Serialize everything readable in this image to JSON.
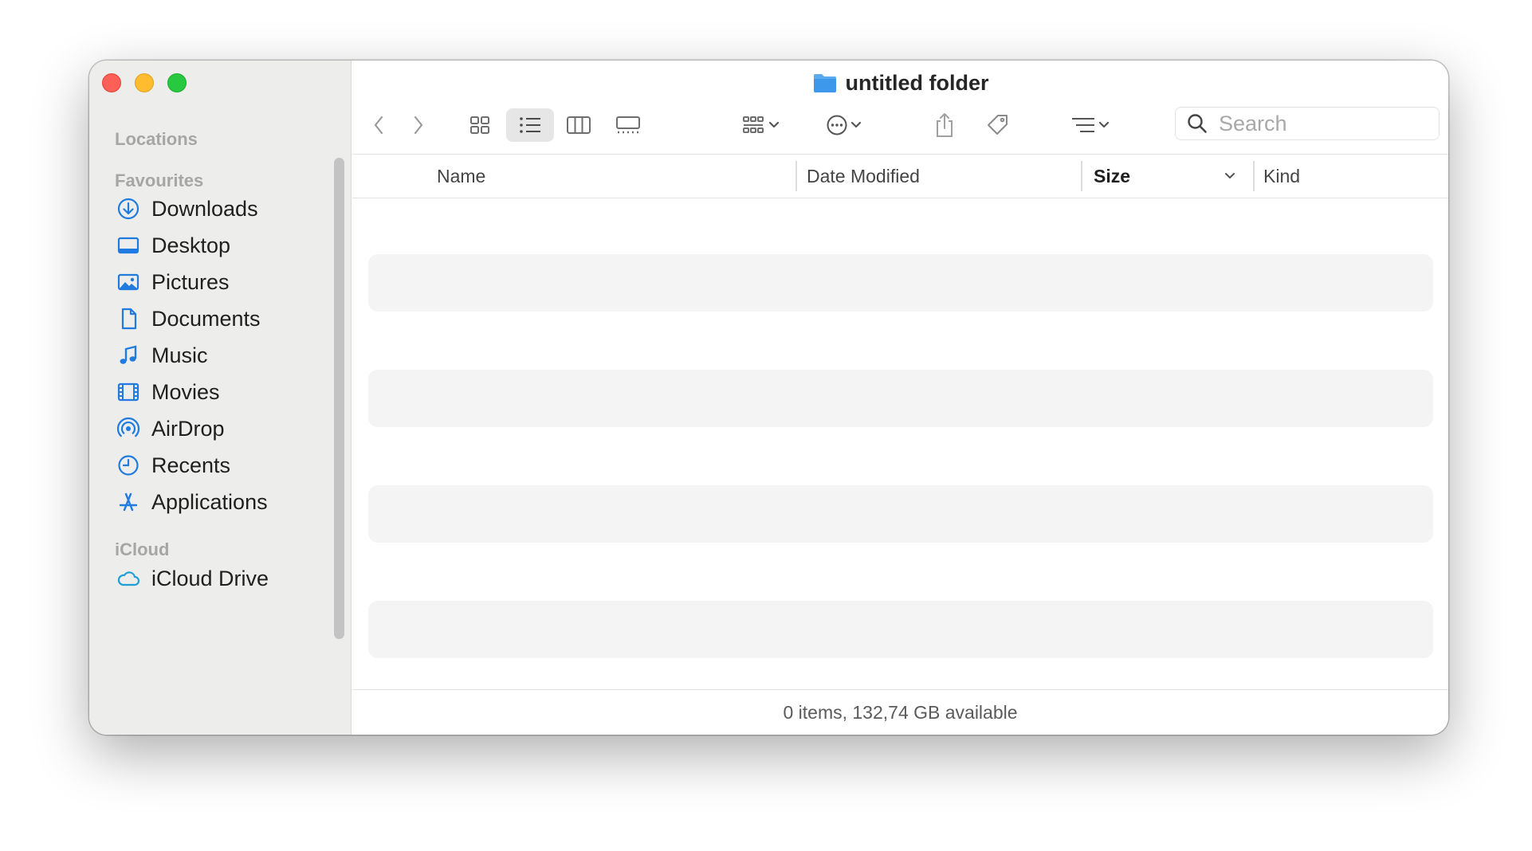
{
  "window": {
    "title": "untitled folder"
  },
  "sidebar": {
    "sections": {
      "locations": "Locations",
      "favourites": "Favourites",
      "icloud": "iCloud"
    },
    "favourites": [
      {
        "label": "Downloads",
        "icon": "download-icon"
      },
      {
        "label": "Desktop",
        "icon": "desktop-icon"
      },
      {
        "label": "Pictures",
        "icon": "pictures-icon"
      },
      {
        "label": "Documents",
        "icon": "document-icon"
      },
      {
        "label": "Music",
        "icon": "music-note-icon"
      },
      {
        "label": "Movies",
        "icon": "film-icon"
      },
      {
        "label": "AirDrop",
        "icon": "airdrop-icon"
      },
      {
        "label": "Recents",
        "icon": "clock-icon"
      },
      {
        "label": "Applications",
        "icon": "applications-icon"
      }
    ],
    "icloud_items": [
      {
        "label": "iCloud Drive",
        "icon": "cloud-icon"
      }
    ]
  },
  "search": {
    "placeholder": "Search",
    "value": ""
  },
  "columns": {
    "name": "Name",
    "date_modified": "Date Modified",
    "size": "Size",
    "kind": "Kind"
  },
  "status": "0 items, 132,74 GB available",
  "colors": {
    "accent": "#1f7be0",
    "sidebar_bg": "#ededec",
    "selected_view_bg": "#e6e6e6",
    "stripe": "#f4f4f4"
  }
}
